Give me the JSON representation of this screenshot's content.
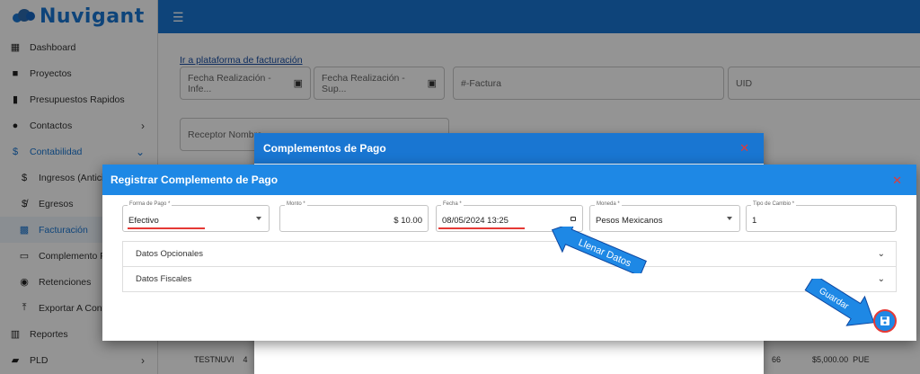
{
  "app": {
    "logo_text": "Nuvigant",
    "menu_icon": "hamburger-icon"
  },
  "sidebar": {
    "items": [
      {
        "label": "Dashboard",
        "icon": "dashboard-icon"
      },
      {
        "label": "Proyectos",
        "icon": "briefcase-icon"
      },
      {
        "label": "Presupuestos Rapidos",
        "icon": "receipt-icon"
      },
      {
        "label": "Contactos",
        "icon": "account-icon"
      },
      {
        "label": "Contabilidad",
        "icon": "dollar-icon"
      },
      {
        "label": "Ingresos (Anticip",
        "icon": "dollar-icon"
      },
      {
        "label": "Egresos",
        "icon": "dollar-off-icon"
      },
      {
        "label": "Facturación",
        "icon": "qr-icon"
      },
      {
        "label": "Complemento Pa",
        "icon": "card-icon"
      },
      {
        "label": "Retenciones",
        "icon": "coin-icon"
      },
      {
        "label": "Exportar A Contp",
        "icon": "upload-icon"
      },
      {
        "label": "Reportes",
        "icon": "chart-icon"
      },
      {
        "label": "PLD",
        "icon": "folder-icon"
      }
    ]
  },
  "page": {
    "link": "Ir a plataforma de facturación",
    "filters": {
      "fecha_inf": "Fecha Realización - Infe...",
      "fecha_sup": "Fecha Realización - Sup...",
      "factura": "#-Factura",
      "uid": "UID",
      "receptor": "Receptor Nombre"
    },
    "bg_row": {
      "col1": "TESTNUVI",
      "col2": "4",
      "col3": "66",
      "col4": "$5,000.00",
      "col5": "PUE"
    }
  },
  "dialog_back": {
    "title": "Complementos de Pago",
    "close": "✕"
  },
  "dialog_front": {
    "title": "Registrar Complemento de Pago",
    "close": "✕",
    "fields": {
      "forma_label": "Forma de Pago *",
      "forma_value": "Efectivo",
      "monto_label": "Monto *",
      "monto_value": "$ 10.00",
      "fecha_label": "Fecha *",
      "fecha_value": "08/05/2024 13:25",
      "moneda_label": "Moneda *",
      "moneda_value": "Pesos Mexicanos",
      "tipo_label": "Tipo de Cambio *",
      "tipo_value": "1"
    },
    "sections": [
      "Datos Opcionales",
      "Datos Fiscales"
    ]
  },
  "annotations": {
    "llenar": "Llenar Datos",
    "guardar": "Guardar",
    "color": "#1e88e5",
    "highlight": "#e53935"
  }
}
